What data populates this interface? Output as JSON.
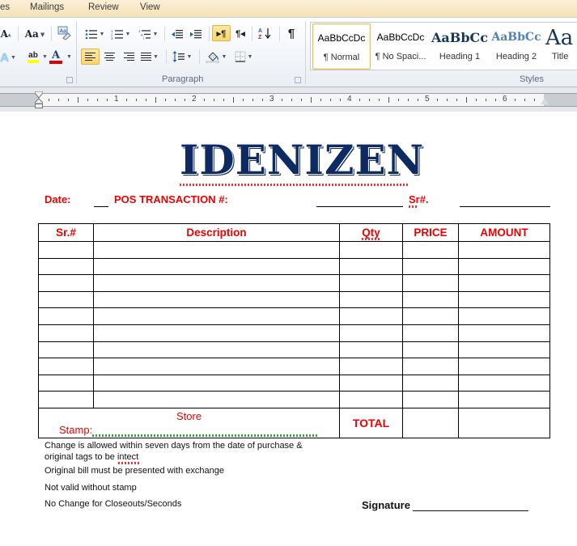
{
  "tabs": [
    {
      "label": "es"
    },
    {
      "label": "Mailings"
    },
    {
      "label": "Review"
    },
    {
      "label": "View"
    }
  ],
  "ribbon": {
    "font_group": {
      "grow_font": "A",
      "change_case": "Aa",
      "clear_format": "A̲",
      "text_effects": "A",
      "highlight": "ab",
      "font_color": "A",
      "highlight_color": "#ffff00",
      "font_color_bar": "#e00000"
    },
    "paragraph_group": {
      "label": "Paragraph",
      "ltr_active": true,
      "align_left_active": true,
      "show_marks": "¶",
      "ltr_label": "▸¶",
      "rtl_label": "¶◂",
      "sort_label": "A↓"
    },
    "styles_group": {
      "label": "Styles",
      "items": [
        {
          "sample": "AaBbCcDc",
          "name": "¶ Normal",
          "selected": true
        },
        {
          "sample": "AaBbCcDc",
          "name": "¶ No Spaci...",
          "selected": false
        },
        {
          "sample": "AaBbCс",
          "name": "Heading 1",
          "selected": false
        },
        {
          "sample": "AaBbCc",
          "name": "Heading 2",
          "selected": false
        },
        {
          "sample": "Aa",
          "name": "Title",
          "selected": false
        }
      ]
    }
  },
  "ruler": {
    "numbers": [
      "1",
      "2",
      "3",
      "4",
      "5",
      "6"
    ]
  },
  "document": {
    "title": "IDENIZEN",
    "header_fields": {
      "date_label": "Date:",
      "pos_label": "POS TRANSACTION #:",
      "sr_label": "Sr#."
    },
    "table": {
      "columns": [
        "Sr.#",
        "Description",
        "Qty",
        "PRICE",
        "AMOUNT"
      ],
      "rows": [
        [
          "",
          "",
          "",
          "",
          ""
        ],
        [
          "",
          "",
          "",
          "",
          ""
        ],
        [
          "",
          "",
          "",
          "",
          ""
        ],
        [
          "",
          "",
          "",
          "",
          ""
        ],
        [
          "",
          "",
          "",
          "",
          ""
        ],
        [
          "",
          "",
          "",
          "",
          ""
        ],
        [
          "",
          "",
          "",
          "",
          ""
        ],
        [
          "",
          "",
          "",
          "",
          ""
        ],
        [
          "",
          "",
          "",
          "",
          ""
        ],
        [
          "",
          "",
          "",
          "",
          ""
        ]
      ],
      "store_label": "Store",
      "stamp_label": "Stamp:",
      "total_label": "TOTAL"
    },
    "notes": [
      "Change  is allowed within seven days from the date of purchase &",
      "original tags to be intect",
      "Original bill must be presented  with exchange",
      "Not valid without stamp",
      "No Change for Closeouts/Seconds"
    ],
    "signature_label": "Signature"
  }
}
